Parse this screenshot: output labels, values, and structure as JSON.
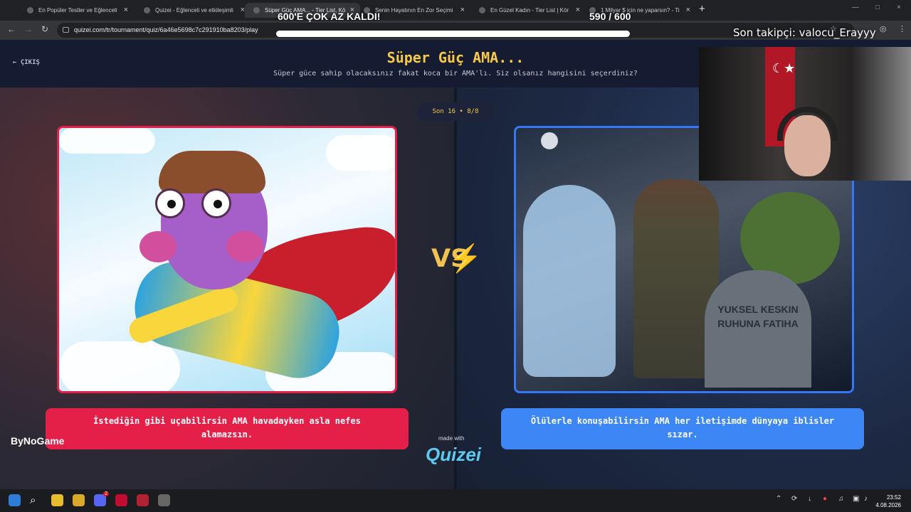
{
  "browser": {
    "tabs": [
      {
        "title": "En Popüler Testler ve Eğlenceli",
        "active": false
      },
      {
        "title": "Quizei - Eğlenceli ve etkileşimli",
        "active": false
      },
      {
        "title": "Süper Güç AMA... - Tier List, Kö",
        "active": true
      },
      {
        "title": "Senin Hayatının En Zor Seçimi",
        "active": false
      },
      {
        "title": "En Güzel Kadın - Tier List | Kör",
        "active": false
      },
      {
        "title": "1 Milyar $ için ne yaparsın? - Ti",
        "active": false
      }
    ],
    "url": "quizei.com/tr/tournament/quiz/6a46e5698c7c291910ba8203/play",
    "new_tab": "+",
    "close_tab": "×"
  },
  "stream_overlay": {
    "goal_title": "600'E ÇOK AZ KALDI!",
    "goal_count": "590 / 600",
    "goal_progress": 0.983,
    "last_follower": "Son takipçi: valocu_Erayyy"
  },
  "page": {
    "exit_label": "ÇIKIŞ",
    "title": "Süper Güç AMA...",
    "subtitle": "Süper güce sahip olacaksınız fakat koca bir AMA'lı. Siz olsanız hangisini seçerdiniz?",
    "round": "Son 16 • 8/8",
    "left_choice": "İstediğin gibi uçabilirsin AMA havadayken asla nefes alamazsın.",
    "right_choice": "Ölülerle konuşabilirsin AMA her iletişimde dünyaya iblisler sızar.",
    "grave_text": "YUKSEL KESKIN RUHUNA FATIHA",
    "vs": "VS",
    "made_with": "made with",
    "brand": "Quizei",
    "partner": "ByNoGame"
  },
  "taskbar": {
    "time": "23:52",
    "date": "4.08.2026",
    "badge": "2"
  },
  "colors": {
    "accent": "#f7c948",
    "left": "#e52048",
    "right": "#3d86f5"
  }
}
